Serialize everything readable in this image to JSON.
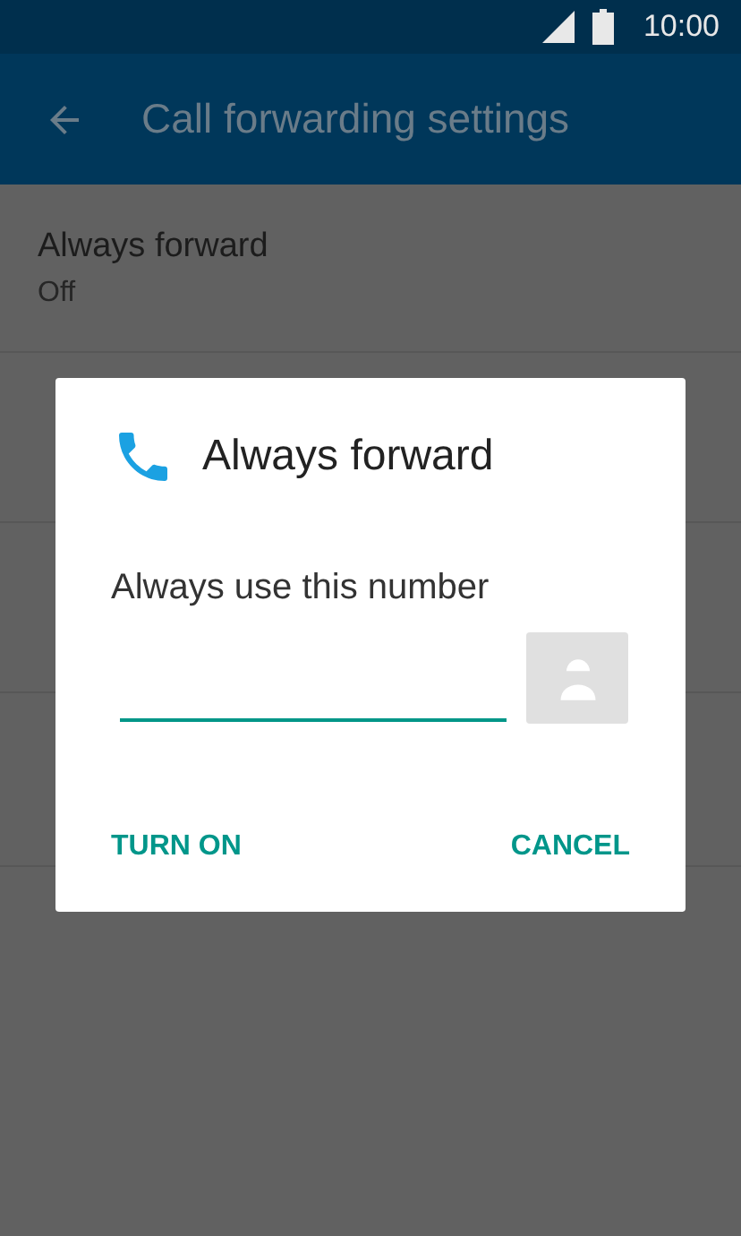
{
  "status_bar": {
    "time": "10:00"
  },
  "app_bar": {
    "title": "Call forwarding settings"
  },
  "settings": [
    {
      "title": "Always forward",
      "summary": "Off"
    }
  ],
  "dialog": {
    "title": "Always forward",
    "label": "Always use this number",
    "buttons": [
      "TURN ON",
      "CANCEL"
    ]
  }
}
